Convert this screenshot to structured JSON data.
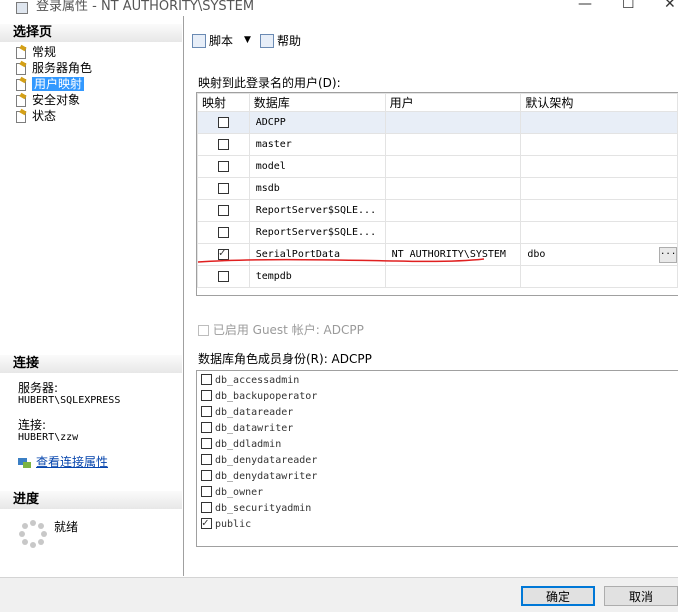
{
  "window": {
    "title": "登录属性 - NT AUTHORITY\\SYSTEM",
    "minimize": "—",
    "maximize": "☐",
    "close": "✕"
  },
  "left": {
    "select_page_header": "选择页",
    "pages": [
      {
        "label": "常规"
      },
      {
        "label": "服务器角色"
      },
      {
        "label": "用户映射",
        "selected": true
      },
      {
        "label": "安全对象"
      },
      {
        "label": "状态"
      }
    ],
    "connection_header": "连接",
    "server_label": "服务器:",
    "server_value": "HUBERT\\SQLEXPRESS",
    "connection_label": "连接:",
    "connection_value": "HUBERT\\zzw",
    "view_props_link": "查看连接属性",
    "progress_header": "进度",
    "progress_status": "就绪"
  },
  "toolbar": {
    "script_label": "脚本",
    "dropdown_arrow": "▼",
    "help_label": "帮助"
  },
  "mapping": {
    "label": "映射到此登录名的用户(D):",
    "columns": {
      "map": "映射",
      "database": "数据库",
      "user": "用户",
      "default_schema": "默认架构"
    },
    "rows": [
      {
        "mapped": false,
        "database": "ADCPP",
        "user": "",
        "schema": "",
        "selected": true
      },
      {
        "mapped": false,
        "database": "master",
        "user": "",
        "schema": ""
      },
      {
        "mapped": false,
        "database": "model",
        "user": "",
        "schema": ""
      },
      {
        "mapped": false,
        "database": "msdb",
        "user": "",
        "schema": ""
      },
      {
        "mapped": false,
        "database": "ReportServer$SQLE...",
        "user": "",
        "schema": ""
      },
      {
        "mapped": false,
        "database": "ReportServer$SQLE...",
        "user": "",
        "schema": ""
      },
      {
        "mapped": true,
        "database": "SerialPortData",
        "user": "NT AUTHORITY\\SYSTEM",
        "schema": "dbo",
        "ellipsis": "..."
      },
      {
        "mapped": false,
        "database": "tempdb",
        "user": "",
        "schema": ""
      }
    ]
  },
  "guest": {
    "label": "已启用 Guest 帐户: ADCPP"
  },
  "roles": {
    "label": "数据库角色成员身份(R): ADCPP",
    "items": [
      {
        "name": "db_accessadmin",
        "checked": false
      },
      {
        "name": "db_backupoperator",
        "checked": false
      },
      {
        "name": "db_datareader",
        "checked": false
      },
      {
        "name": "db_datawriter",
        "checked": false
      },
      {
        "name": "db_ddladmin",
        "checked": false
      },
      {
        "name": "db_denydatareader",
        "checked": false
      },
      {
        "name": "db_denydatawriter",
        "checked": false
      },
      {
        "name": "db_owner",
        "checked": false
      },
      {
        "name": "db_securityadmin",
        "checked": false
      },
      {
        "name": "public",
        "checked": true
      }
    ]
  },
  "buttons": {
    "ok": "确定",
    "cancel": "取消"
  },
  "colors": {
    "selection": "#3399ff",
    "link": "#0645ad",
    "annotation": "#e02020"
  }
}
